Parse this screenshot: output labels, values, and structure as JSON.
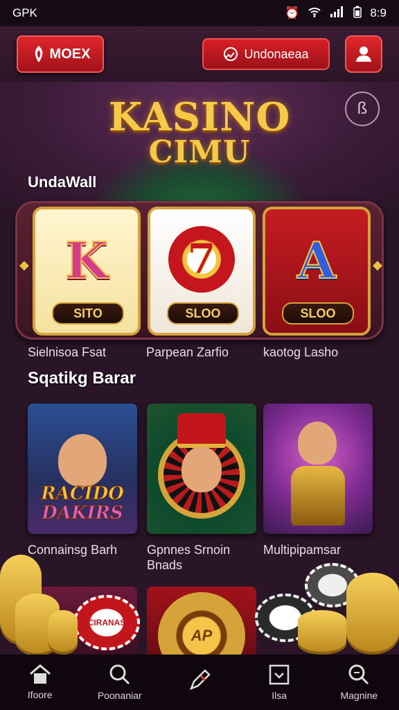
{
  "status_bar": {
    "carrier": "GPK",
    "time": "8:9"
  },
  "header": {
    "logo_text": "MOEX",
    "language": "Undonaeaa"
  },
  "hero": {
    "title_line1": "KASINO",
    "title_line2": "CIMU"
  },
  "section1": {
    "title": "UndaWall"
  },
  "reels": [
    {
      "symbol": "K",
      "badge": "SITO",
      "caption": "Sielnisoa Fsat"
    },
    {
      "symbol": "7",
      "badge": "SLOO",
      "caption": "Parpean Zarfio"
    },
    {
      "symbol": "A",
      "badge": "SLOO",
      "caption": "kaotog Lasho"
    }
  ],
  "section2": {
    "title": "Sqatikg Barar"
  },
  "games": [
    {
      "logo_line1": "RACIDO",
      "logo_line2": "DAKIRS",
      "caption": "Connainsg Barh"
    },
    {
      "caption_line1": "Gpnnes Srnoin",
      "caption_line2": "Bnads"
    },
    {
      "caption": "Multipipamsar"
    }
  ],
  "bottom_art": {
    "chip_text": "CIRANAS",
    "roulette_text": "AP"
  },
  "nav": [
    {
      "label": "Ifoore",
      "icon": "home-icon"
    },
    {
      "label": "Poonaniar",
      "icon": "search-icon"
    },
    {
      "label": "",
      "icon": "pen-icon"
    },
    {
      "label": "Ilsa",
      "icon": "box-icon"
    },
    {
      "label": "Magnine",
      "icon": "magnifier-icon"
    }
  ],
  "colors": {
    "accent_red": "#d81f26",
    "gold": "#f7c948",
    "background": "#2a1528"
  }
}
